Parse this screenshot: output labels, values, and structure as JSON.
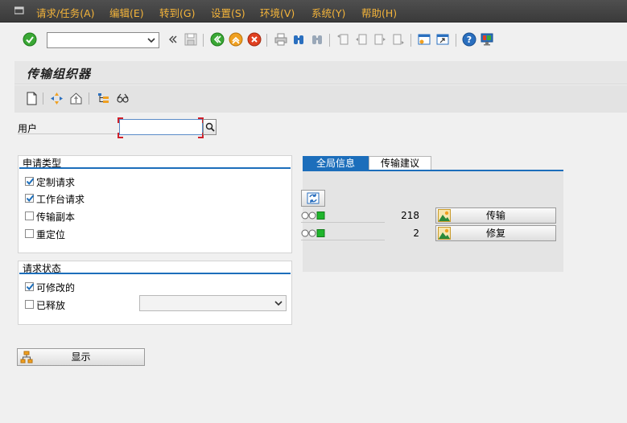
{
  "menu": {
    "items": [
      "请求/任务(A)",
      "编辑(E)",
      "转到(G)",
      "设置(S)",
      "环境(V)",
      "系统(Y)",
      "帮助(H)"
    ]
  },
  "toolbar": {
    "command_field_value": ""
  },
  "page": {
    "title": "传输组织器"
  },
  "user_field": {
    "label": "用户",
    "value": ""
  },
  "request_type": {
    "title": "申请类型",
    "options": [
      {
        "label": "定制请求",
        "checked": true
      },
      {
        "label": "工作台请求",
        "checked": true
      },
      {
        "label": "传输副本",
        "checked": false
      },
      {
        "label": "重定位",
        "checked": false
      }
    ]
  },
  "request_status": {
    "title": "请求状态",
    "options": [
      {
        "label": "可修改的",
        "checked": true
      },
      {
        "label": "已释放",
        "checked": false
      }
    ],
    "release_select_value": ""
  },
  "tabs": [
    {
      "label": "全局信息",
      "active": true
    },
    {
      "label": "传输建议",
      "active": false
    }
  ],
  "global_info": {
    "rows": [
      {
        "count": "218",
        "button_label": "传输"
      },
      {
        "count": "2",
        "button_label": "修复"
      }
    ]
  },
  "actions": {
    "display_label": "显示"
  },
  "colors": {
    "menu_text": "#f4b43a",
    "accent_blue": "#1c6ebb",
    "status_green": "#1fb52c"
  }
}
